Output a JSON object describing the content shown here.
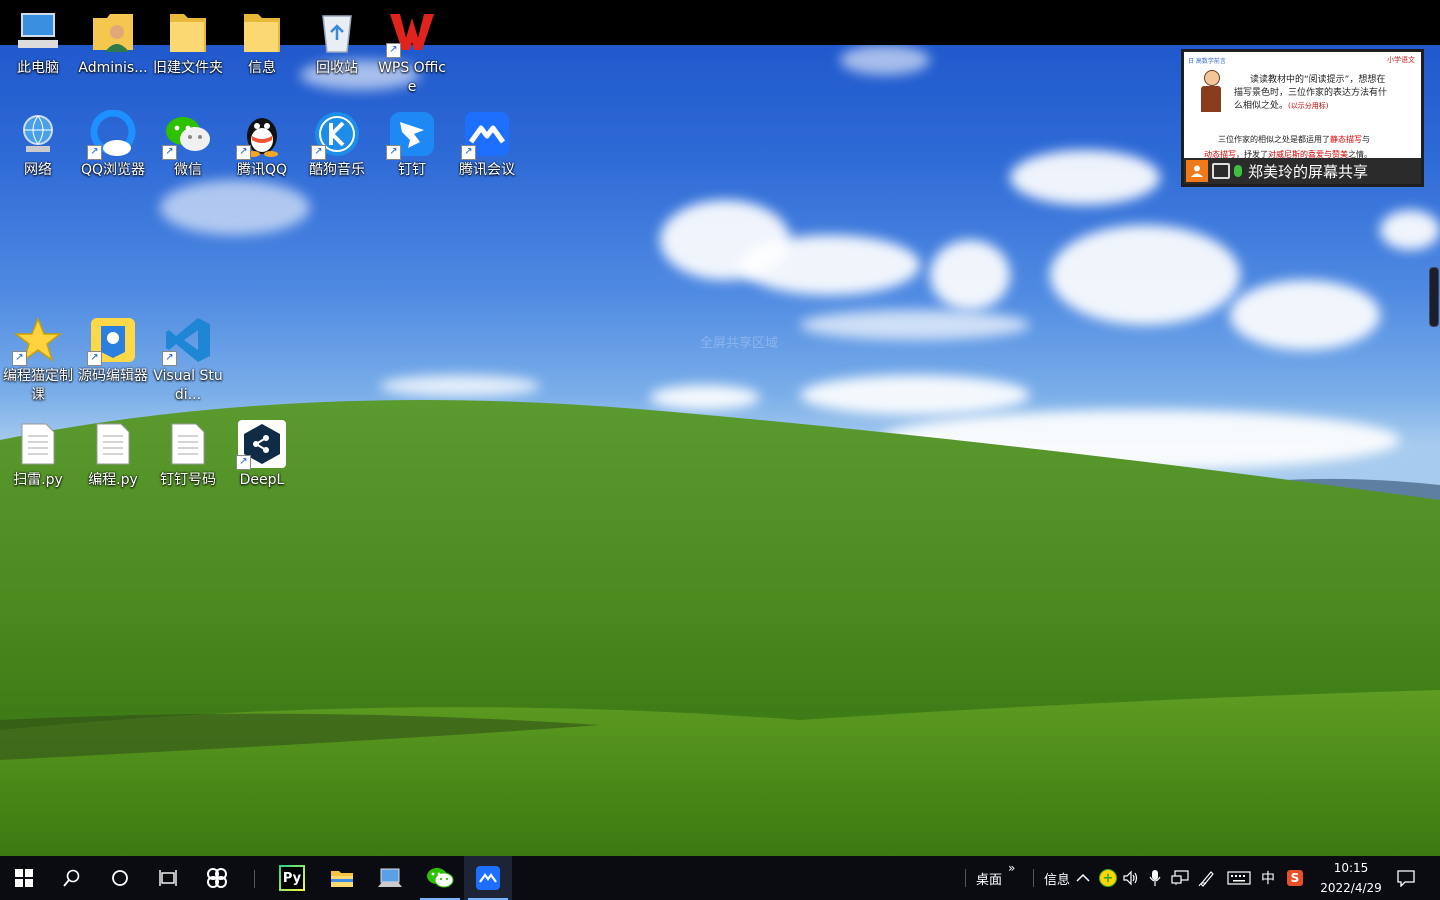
{
  "desktop": {
    "watermark": "全屏共享区域",
    "icons": [
      {
        "label": "此电脑",
        "icon": "computer-icon"
      },
      {
        "label": "Adminis...",
        "icon": "user-folder-icon"
      },
      {
        "label": "旧建文件夹",
        "icon": "folder-icon"
      },
      {
        "label": "信息",
        "icon": "folder-icon"
      },
      {
        "label": "回收站",
        "icon": "recycle-bin-icon"
      },
      {
        "label": "WPS Office",
        "icon": "wps-icon"
      },
      {
        "label": "网络",
        "icon": "network-icon"
      },
      {
        "label": "QQ浏览器",
        "icon": "qq-browser-icon"
      },
      {
        "label": "微信",
        "icon": "wechat-icon"
      },
      {
        "label": "腾讯QQ",
        "icon": "qq-icon"
      },
      {
        "label": "酷狗音乐",
        "icon": "kugou-icon"
      },
      {
        "label": "钉钉",
        "icon": "dingtalk-icon"
      },
      {
        "label": "腾讯会议",
        "icon": "tencent-meeting-icon"
      },
      {
        "label": "编程猫定制课",
        "icon": "star-icon"
      },
      {
        "label": "源码编辑器",
        "icon": "code-editor-icon"
      },
      {
        "label": "Visual Studi...",
        "icon": "vscode-icon"
      },
      {
        "label": "扫雷.py",
        "icon": "file-icon"
      },
      {
        "label": "编程.py",
        "icon": "file-icon"
      },
      {
        "label": "钉钉号码",
        "icon": "file-icon"
      },
      {
        "label": "DeepL",
        "icon": "deepl-icon"
      }
    ]
  },
  "screen_share": {
    "title": "郑美玲的屏幕共享",
    "slide_header": "日 高数学前言",
    "slide_corner": "小学语文",
    "slide_line1": "读读教材中的“阅读提示”，想想在",
    "slide_line2": "描写景色时，三位作家的表达方法有什",
    "slide_line3": "么相似之处。",
    "slide_line3_red": "(以示分用标)",
    "slide_line4a": "三位作家的相似之处是都运用了",
    "slide_line4b": "静态描写",
    "slide_line4c": "与",
    "slide_line5a": "动态描写",
    "slide_line5b": "，抒发了",
    "slide_line5c": "对威尼斯的喜爱与赞美",
    "slide_line5d": "之情。"
  },
  "taskbar": {
    "left_icons": [
      "windows-start-icon",
      "search-icon",
      "cortana-icon",
      "task-view-icon",
      "pinwheel-app-icon"
    ],
    "apps": [
      {
        "name": "pycharm-icon",
        "label": "Py"
      },
      {
        "name": "file-explorer-icon"
      },
      {
        "name": "remote-desktop-icon"
      },
      {
        "name": "wechat-icon"
      },
      {
        "name": "tencent-meeting-icon"
      }
    ],
    "toolbar_desktop": "桌面",
    "toolbar_chevron": "»",
    "toolbar_info": "信息",
    "ime": "中",
    "time": "10:15",
    "date": "2022/4/29"
  }
}
